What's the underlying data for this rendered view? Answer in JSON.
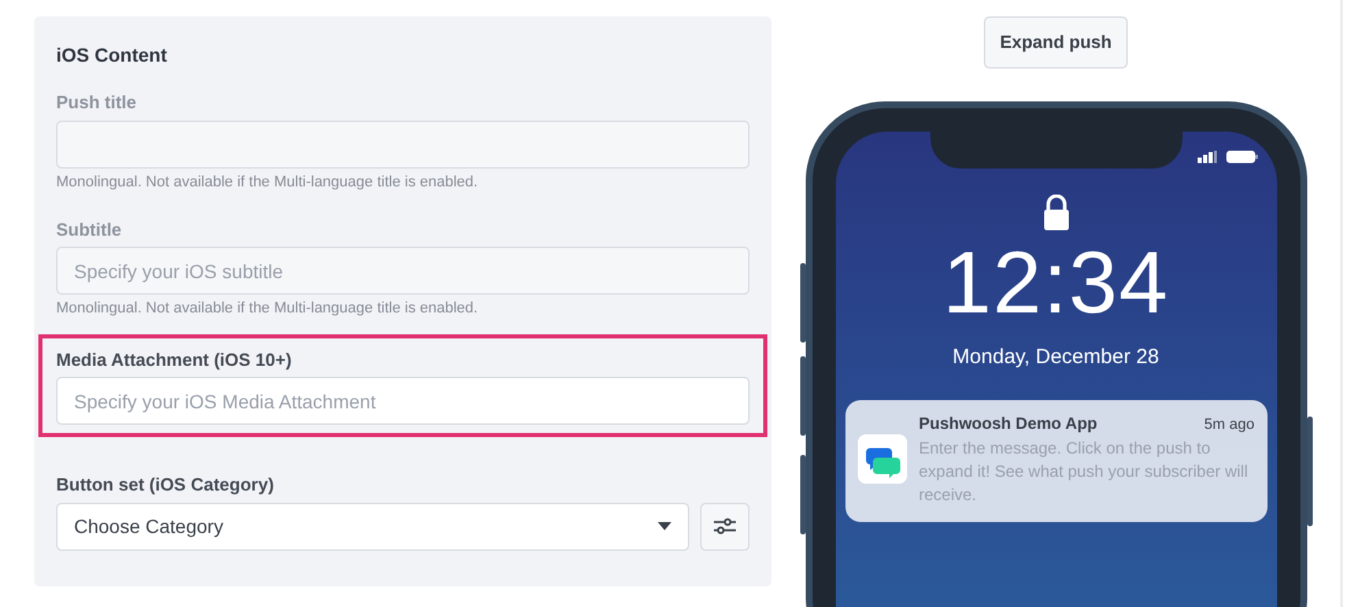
{
  "panel": {
    "title": "iOS Content",
    "fields": [
      {
        "kind": "text",
        "label": "Push title",
        "disabled": true,
        "highlighted": false,
        "hint": "Monolingual. Not available if the Multi-language title is enabled."
      },
      {
        "kind": "text",
        "label": "Subtitle",
        "placeholder": "Specify your iOS subtitle",
        "disabled": true,
        "highlighted": false,
        "hint": "Monolingual. Not available if the Multi-language title is enabled."
      },
      {
        "kind": "text",
        "label": "Media Attachment (iOS 10+)",
        "placeholder": "Specify your iOS Media Attachment",
        "disabled": false,
        "highlighted": true
      },
      {
        "kind": "select",
        "label": "Button set (iOS Category)",
        "value": "Choose Category",
        "disabled": false,
        "highlighted": false
      }
    ]
  },
  "preview": {
    "button": "Expand push",
    "lock_screen": {
      "time": "12:34",
      "date": "Monday, December 28"
    },
    "notification": {
      "app": "Pushwoosh Demo App",
      "time": "5m ago",
      "message": "Enter the message. Click on the push to expand it! See what push your subscriber will receive."
    }
  }
}
